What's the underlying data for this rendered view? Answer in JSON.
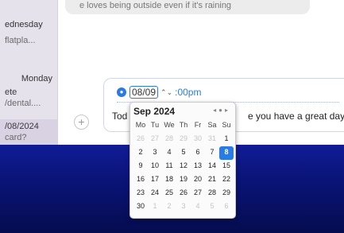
{
  "sidebar": {
    "conversations": [
      {
        "name": "",
        "date": "ednesday",
        "snippet": "flatpla..."
      },
      {
        "name": "Monday",
        "date": "ete",
        "snippet": "/dental...."
      },
      {
        "name": "",
        "date": "/08/2024",
        "snippet": "card?"
      }
    ]
  },
  "chat": {
    "top_message": "e loves being outside even if it's raining"
  },
  "composer": {
    "clock_glyph": "🕓",
    "date_value": "08/09",
    "stepper_glyph": "⌃⌄",
    "time_value": ":00pm",
    "message_left": "Tod",
    "message_right": "e you have a great day!",
    "add_button": "+"
  },
  "calendar": {
    "month_label": "Sep 2024",
    "nav": {
      "prev": "◂",
      "today": "●",
      "next": "▸"
    },
    "weekdays": [
      "Mo",
      "Tu",
      "We",
      "Th",
      "Fr",
      "Sa",
      "Su"
    ],
    "days": [
      {
        "d": "26",
        "dim": true
      },
      {
        "d": "27",
        "dim": true
      },
      {
        "d": "28",
        "dim": true
      },
      {
        "d": "29",
        "dim": true
      },
      {
        "d": "30",
        "dim": true
      },
      {
        "d": "31",
        "dim": true
      },
      {
        "d": "1",
        "dim": false
      },
      {
        "d": "2",
        "dim": false
      },
      {
        "d": "3",
        "dim": false
      },
      {
        "d": "4",
        "dim": false
      },
      {
        "d": "5",
        "dim": false
      },
      {
        "d": "6",
        "dim": false
      },
      {
        "d": "7",
        "dim": false
      },
      {
        "d": "8",
        "dim": false,
        "selected": true
      },
      {
        "d": "9",
        "dim": false
      },
      {
        "d": "10",
        "dim": false
      },
      {
        "d": "11",
        "dim": false
      },
      {
        "d": "12",
        "dim": false
      },
      {
        "d": "13",
        "dim": false
      },
      {
        "d": "14",
        "dim": false
      },
      {
        "d": "15",
        "dim": false
      },
      {
        "d": "16",
        "dim": false
      },
      {
        "d": "17",
        "dim": false
      },
      {
        "d": "18",
        "dim": false
      },
      {
        "d": "19",
        "dim": false
      },
      {
        "d": "20",
        "dim": false
      },
      {
        "d": "21",
        "dim": false
      },
      {
        "d": "22",
        "dim": false
      },
      {
        "d": "23",
        "dim": false
      },
      {
        "d": "24",
        "dim": false
      },
      {
        "d": "25",
        "dim": false
      },
      {
        "d": "26",
        "dim": false
      },
      {
        "d": "27",
        "dim": false
      },
      {
        "d": "28",
        "dim": false
      },
      {
        "d": "29",
        "dim": false
      },
      {
        "d": "30",
        "dim": false
      },
      {
        "d": "1",
        "dim": true
      },
      {
        "d": "2",
        "dim": true
      },
      {
        "d": "3",
        "dim": true
      },
      {
        "d": "4",
        "dim": true
      },
      {
        "d": "5",
        "dim": true
      },
      {
        "d": "6",
        "dim": true
      }
    ],
    "accent_color": "#2b7be4"
  }
}
